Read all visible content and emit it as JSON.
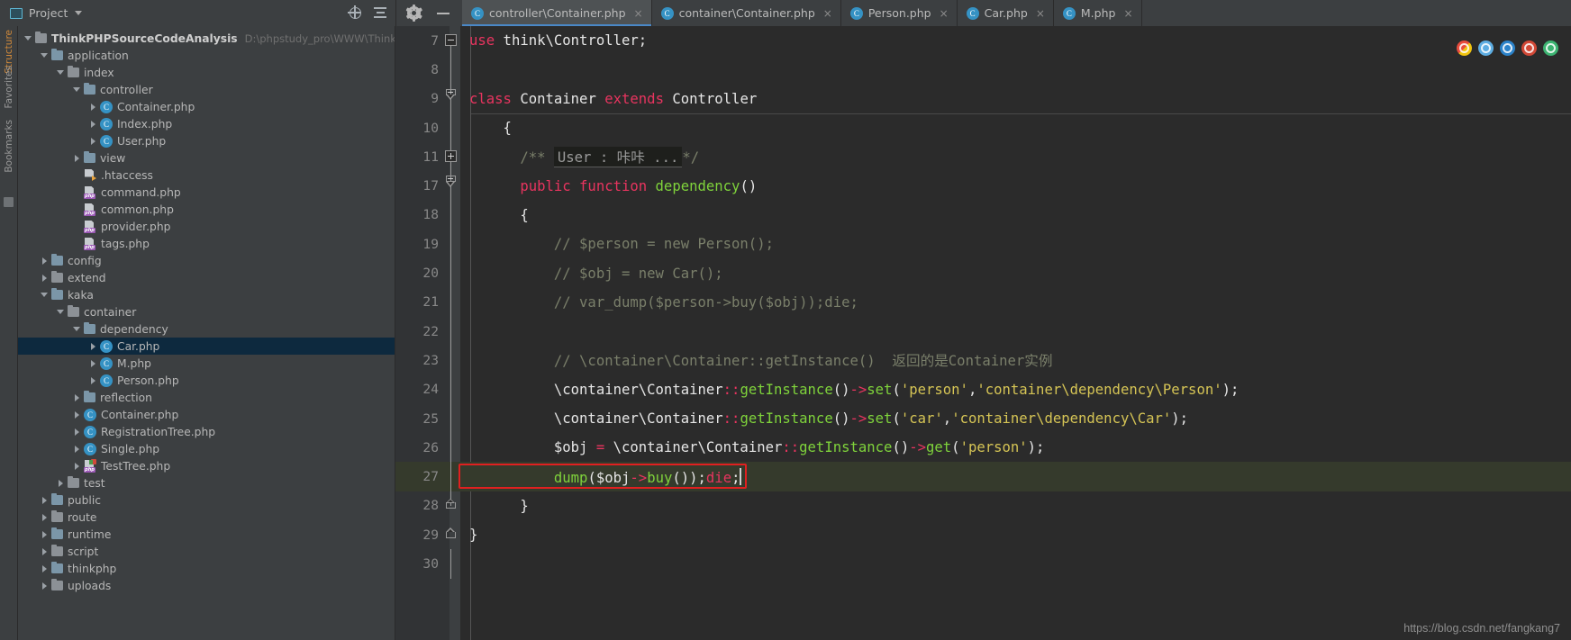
{
  "app": {
    "tool_window_title": "Project",
    "watermark": "https://blog.csdn.net/fangkang7"
  },
  "project_panel": {
    "title": "Project",
    "icons": [
      "locate-icon",
      "collapse-all-icon"
    ],
    "vertical_tabs": [
      "Structure",
      "Favorites",
      "Bookmarks"
    ],
    "root": {
      "label": "ThinkPHPSourceCodeAnalysis",
      "path": "D:\\phpstudy_pro\\WWW\\ThinkPHPSourceCo"
    },
    "items": [
      {
        "label": "application",
        "type": "folder",
        "indent": 1,
        "state": "expanded"
      },
      {
        "label": "index",
        "type": "folder",
        "indent": 2,
        "state": "expanded"
      },
      {
        "label": "controller",
        "type": "folder",
        "indent": 3,
        "state": "expanded"
      },
      {
        "label": "Container.php",
        "type": "class",
        "indent": 4,
        "state": "collapsed"
      },
      {
        "label": "Index.php",
        "type": "class",
        "indent": 4,
        "state": "collapsed"
      },
      {
        "label": "User.php",
        "type": "class",
        "indent": 4,
        "state": "collapsed"
      },
      {
        "label": "view",
        "type": "folder",
        "indent": 3,
        "state": "collapsed"
      },
      {
        "label": ".htaccess",
        "type": "htaccess",
        "indent": 3,
        "state": "none"
      },
      {
        "label": "command.php",
        "type": "php",
        "indent": 3,
        "state": "none"
      },
      {
        "label": "common.php",
        "type": "php",
        "indent": 3,
        "state": "none"
      },
      {
        "label": "provider.php",
        "type": "php",
        "indent": 3,
        "state": "none"
      },
      {
        "label": "tags.php",
        "type": "php",
        "indent": 3,
        "state": "none"
      },
      {
        "label": "config",
        "type": "folder",
        "indent": 1,
        "state": "collapsed"
      },
      {
        "label": "extend",
        "type": "folder",
        "indent": 1,
        "state": "collapsed"
      },
      {
        "label": "kaka",
        "type": "folder",
        "indent": 1,
        "state": "expanded"
      },
      {
        "label": "container",
        "type": "folder",
        "indent": 2,
        "state": "expanded"
      },
      {
        "label": "dependency",
        "type": "folder",
        "indent": 3,
        "state": "expanded"
      },
      {
        "label": "Car.php",
        "type": "class",
        "indent": 4,
        "state": "collapsed",
        "selected": true
      },
      {
        "label": "M.php",
        "type": "class",
        "indent": 4,
        "state": "collapsed"
      },
      {
        "label": "Person.php",
        "type": "class",
        "indent": 4,
        "state": "collapsed"
      },
      {
        "label": "reflection",
        "type": "folder",
        "indent": 3,
        "state": "collapsed"
      },
      {
        "label": "Container.php",
        "type": "class",
        "indent": 3,
        "state": "collapsed"
      },
      {
        "label": "RegistrationTree.php",
        "type": "class",
        "indent": 3,
        "state": "collapsed"
      },
      {
        "label": "Single.php",
        "type": "class",
        "indent": 3,
        "state": "collapsed"
      },
      {
        "label": "TestTree.php",
        "type": "phptest",
        "indent": 3,
        "state": "collapsed"
      },
      {
        "label": "test",
        "type": "folder",
        "indent": 2,
        "state": "collapsed"
      },
      {
        "label": "public",
        "type": "folder",
        "indent": 1,
        "state": "collapsed"
      },
      {
        "label": "route",
        "type": "folder",
        "indent": 1,
        "state": "collapsed"
      },
      {
        "label": "runtime",
        "type": "folder",
        "indent": 1,
        "state": "collapsed"
      },
      {
        "label": "script",
        "type": "folder",
        "indent": 1,
        "state": "collapsed"
      },
      {
        "label": "thinkphp",
        "type": "folder",
        "indent": 1,
        "state": "collapsed"
      },
      {
        "label": "uploads",
        "type": "folder",
        "indent": 1,
        "state": "collapsed"
      }
    ]
  },
  "window_buttons": {
    "settings": "gear-icon",
    "minimize": "minimize-icon"
  },
  "tabs": [
    {
      "label": "controller\\Container.php",
      "active": true,
      "close": "×"
    },
    {
      "label": "container\\Container.php",
      "active": false,
      "close": "×"
    },
    {
      "label": "Person.php",
      "active": false,
      "close": "×"
    },
    {
      "label": "Car.php",
      "active": false,
      "close": "×"
    },
    {
      "label": "M.php",
      "active": false,
      "close": "×"
    }
  ],
  "editor": {
    "lines": [
      {
        "num": "7",
        "fold": "collapse-box",
        "segments": [
          {
            "t": "use",
            "c": "kwpink"
          },
          {
            "t": " think\\Controller;",
            "c": "wh"
          }
        ]
      },
      {
        "num": "8",
        "fold": "line",
        "segments": []
      },
      {
        "num": "9",
        "fold": "fold-end",
        "segments": [
          {
            "t": "class",
            "c": "kwpink"
          },
          {
            "t": " Container ",
            "c": "wh"
          },
          {
            "t": "extends",
            "c": "kwpink"
          },
          {
            "t": " Controller",
            "c": "wh"
          }
        ]
      },
      {
        "num": "10",
        "fold": "line",
        "segments": [
          {
            "t": "    {",
            "c": "wh"
          }
        ]
      },
      {
        "num": "11",
        "fold": "expand-box",
        "segments": [
          {
            "t": "      /** ",
            "c": "cmt"
          },
          {
            "t": "User : 咔咔 ...",
            "c": "chip"
          },
          {
            "t": "*/",
            "c": "cmt"
          }
        ]
      },
      {
        "num": "17",
        "fold": "fold-mid",
        "segments": [
          {
            "t": "      public function ",
            "c": "kwpink"
          },
          {
            "t": "dependency",
            "c": "fn"
          },
          {
            "t": "()",
            "c": "wh"
          }
        ]
      },
      {
        "num": "18",
        "fold": "line",
        "segments": [
          {
            "t": "      {",
            "c": "wh"
          }
        ]
      },
      {
        "num": "19",
        "fold": "line",
        "segments": [
          {
            "t": "          // $person = new Person();",
            "c": "cmt"
          }
        ]
      },
      {
        "num": "20",
        "fold": "line",
        "segments": [
          {
            "t": "          // $obj = new Car();",
            "c": "cmt"
          }
        ]
      },
      {
        "num": "21",
        "fold": "line",
        "segments": [
          {
            "t": "          // var_dump($person->buy($obj));die;",
            "c": "cmt"
          }
        ]
      },
      {
        "num": "22",
        "fold": "line",
        "segments": []
      },
      {
        "num": "23",
        "fold": "line",
        "segments": [
          {
            "t": "          // \\container\\Container::getInstance()  返回的是Container实例",
            "c": "cmt"
          }
        ]
      },
      {
        "num": "24",
        "fold": "line",
        "segments": [
          {
            "t": "          \\container\\Container",
            "c": "wh"
          },
          {
            "t": "::",
            "c": "op"
          },
          {
            "t": "getInstance",
            "c": "fn"
          },
          {
            "t": "()",
            "c": "wh"
          },
          {
            "t": "->",
            "c": "op"
          },
          {
            "t": "set",
            "c": "fn"
          },
          {
            "t": "(",
            "c": "wh"
          },
          {
            "t": "'person'",
            "c": "str"
          },
          {
            "t": ",",
            "c": "wh"
          },
          {
            "t": "'container\\dependency\\Person'",
            "c": "str"
          },
          {
            "t": ");",
            "c": "wh"
          }
        ]
      },
      {
        "num": "25",
        "fold": "line",
        "segments": [
          {
            "t": "          \\container\\Container",
            "c": "wh"
          },
          {
            "t": "::",
            "c": "op"
          },
          {
            "t": "getInstance",
            "c": "fn"
          },
          {
            "t": "()",
            "c": "wh"
          },
          {
            "t": "->",
            "c": "op"
          },
          {
            "t": "set",
            "c": "fn"
          },
          {
            "t": "(",
            "c": "wh"
          },
          {
            "t": "'car'",
            "c": "str"
          },
          {
            "t": ",",
            "c": "wh"
          },
          {
            "t": "'container\\dependency\\Car'",
            "c": "str"
          },
          {
            "t": ");",
            "c": "wh"
          }
        ]
      },
      {
        "num": "26",
        "fold": "line",
        "segments": [
          {
            "t": "          $obj ",
            "c": "wh"
          },
          {
            "t": "=",
            "c": "op"
          },
          {
            "t": " \\container\\Container",
            "c": "wh"
          },
          {
            "t": "::",
            "c": "op"
          },
          {
            "t": "getInstance",
            "c": "fn"
          },
          {
            "t": "()",
            "c": "wh"
          },
          {
            "t": "->",
            "c": "op"
          },
          {
            "t": "get",
            "c": "fn"
          },
          {
            "t": "(",
            "c": "wh"
          },
          {
            "t": "'person'",
            "c": "str"
          },
          {
            "t": ");",
            "c": "wh"
          }
        ]
      },
      {
        "num": "27",
        "fold": "line",
        "highlighted": true,
        "boxed": true,
        "segments": [
          {
            "t": "          ",
            "c": "wh"
          },
          {
            "t": "dump",
            "c": "fn"
          },
          {
            "t": "(",
            "c": "wh"
          },
          {
            "t": "$obj",
            "c": "wh"
          },
          {
            "t": "->",
            "c": "op"
          },
          {
            "t": "buy",
            "c": "fn"
          },
          {
            "t": "());",
            "c": "wh"
          },
          {
            "t": "die",
            "c": "kwpink"
          },
          {
            "t": ";",
            "c": "wh"
          }
        ]
      },
      {
        "num": "28",
        "fold": "fold-end-up",
        "segments": [
          {
            "t": "      }",
            "c": "wh"
          }
        ]
      },
      {
        "num": "29",
        "fold": "fold-end-up2",
        "segments": [
          {
            "t": "}",
            "c": "wh"
          }
        ]
      },
      {
        "num": "30",
        "fold": "line",
        "segments": []
      }
    ],
    "inspection_icons": [
      "chrome-browser-icon",
      "edge-browser-icon",
      "firefox-browser-icon",
      "opera-browser-icon",
      "safari-browser-icon",
      "ie-browser-icon"
    ]
  }
}
